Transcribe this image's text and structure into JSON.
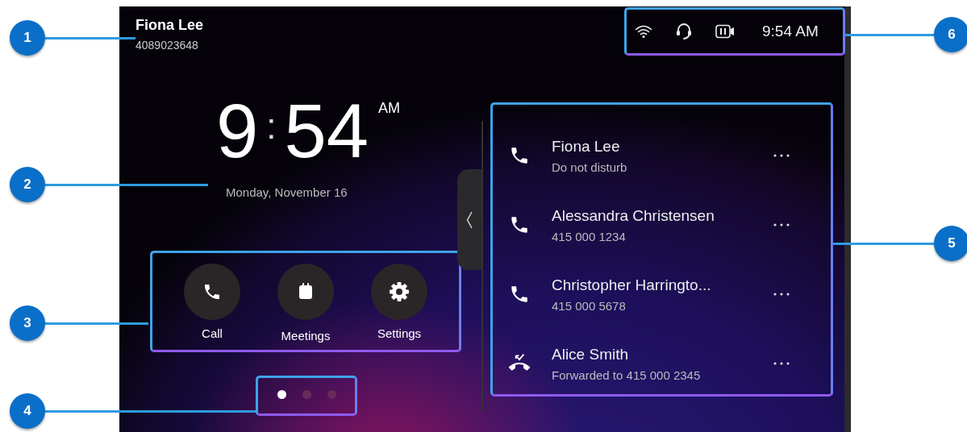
{
  "user": {
    "name": "Fiona Lee",
    "number": "4089023648"
  },
  "status_bar": {
    "time": "9:54 AM"
  },
  "clock": {
    "hour": "9",
    "separator": ":",
    "minute": "54",
    "period": "AM",
    "date": "Monday, November 16"
  },
  "quick_actions": [
    {
      "label": "Call",
      "kind": "call"
    },
    {
      "label": "Meetings",
      "kind": "meetings"
    },
    {
      "label": "Settings",
      "kind": "settings"
    }
  ],
  "page_dots": [
    {
      "selected": true
    },
    {
      "selected": false
    },
    {
      "selected": false
    }
  ],
  "lines": [
    {
      "name": "Fiona Lee",
      "detail": "Do not disturb",
      "kind": "phone"
    },
    {
      "name": "Alessandra Christensen",
      "detail": "415 000 1234",
      "kind": "phone"
    },
    {
      "name": "Christopher Harringto...",
      "detail": "415 000 5678",
      "kind": "phone"
    },
    {
      "name": "Alice Smith",
      "detail": "Forwarded to 415 000 2345",
      "kind": "forwarded"
    }
  ],
  "callouts": [
    "1",
    "2",
    "3",
    "4",
    "6",
    "5"
  ]
}
